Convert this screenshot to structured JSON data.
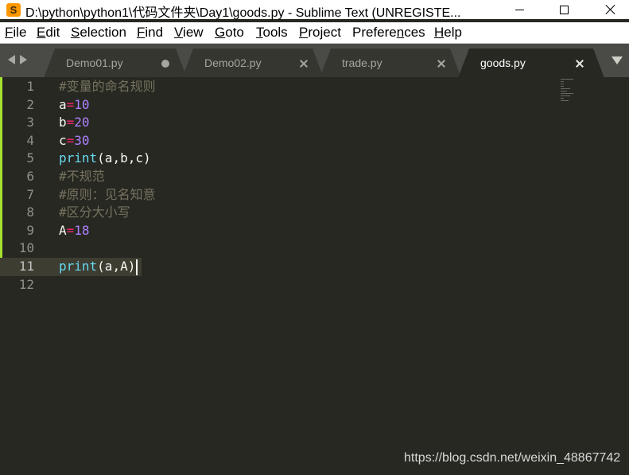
{
  "window": {
    "title": "D:\\python\\python1\\代码文件夹\\Day1\\goods.py - Sublime Text (UNREGISTE...",
    "app_icon_letter": "S"
  },
  "menu": [
    {
      "label": "File",
      "key": "F",
      "rest": "ile"
    },
    {
      "label": "Edit",
      "key": "E",
      "rest": "dit"
    },
    {
      "label": "Selection",
      "key": "S",
      "rest": "election"
    },
    {
      "label": "Find",
      "key": "F",
      "rest": "ind",
      "prefix": ""
    },
    {
      "label": "View",
      "key": "V",
      "rest": "iew"
    },
    {
      "label": "Goto",
      "key": "G",
      "rest": "oto"
    },
    {
      "label": "Tools",
      "key": "T",
      "rest": "ools"
    },
    {
      "label": "Project",
      "key": "P",
      "rest": "roject"
    },
    {
      "label": "Preferences",
      "key": "n",
      "prefix": "Prefere",
      "rest": "ces"
    },
    {
      "label": "Help",
      "key": "H",
      "rest": "elp"
    }
  ],
  "tabs": [
    {
      "label": "Demo01.py",
      "state": "modified",
      "active": false
    },
    {
      "label": "Demo02.py",
      "state": "close",
      "active": false
    },
    {
      "label": "trade.py",
      "state": "close",
      "active": false
    },
    {
      "label": "goods.py",
      "state": "close",
      "active": true
    }
  ],
  "editor": {
    "current_line": 11,
    "lines": [
      {
        "num": "1",
        "tokens": [
          {
            "t": "#变量的命名规则",
            "c": "comment"
          }
        ]
      },
      {
        "num": "2",
        "tokens": [
          {
            "t": "a",
            "c": "plain"
          },
          {
            "t": "=",
            "c": "op"
          },
          {
            "t": "10",
            "c": "num"
          }
        ]
      },
      {
        "num": "3",
        "tokens": [
          {
            "t": "b",
            "c": "plain"
          },
          {
            "t": "=",
            "c": "op"
          },
          {
            "t": "20",
            "c": "num"
          }
        ]
      },
      {
        "num": "4",
        "tokens": [
          {
            "t": "c",
            "c": "plain"
          },
          {
            "t": "=",
            "c": "op"
          },
          {
            "t": "30",
            "c": "num"
          }
        ]
      },
      {
        "num": "5",
        "tokens": [
          {
            "t": "print",
            "c": "fn"
          },
          {
            "t": "(a,b,c)",
            "c": "plain"
          }
        ]
      },
      {
        "num": "6",
        "tokens": [
          {
            "t": "#不规范",
            "c": "comment"
          }
        ]
      },
      {
        "num": "7",
        "tokens": [
          {
            "t": "#原则：见名知意",
            "c": "comment"
          }
        ]
      },
      {
        "num": "8",
        "tokens": [
          {
            "t": "#区分大小写",
            "c": "comment"
          }
        ]
      },
      {
        "num": "9",
        "tokens": [
          {
            "t": "A",
            "c": "plain"
          },
          {
            "t": "=",
            "c": "op"
          },
          {
            "t": "18",
            "c": "num"
          }
        ]
      },
      {
        "num": "10",
        "tokens": []
      },
      {
        "num": "11",
        "tokens": [
          {
            "t": "print",
            "c": "fn"
          },
          {
            "t": "(a,A)",
            "c": "plain"
          }
        ]
      },
      {
        "num": "12",
        "tokens": []
      }
    ]
  },
  "watermark": "https://blog.csdn.net/weixin_48867742",
  "colors": {
    "background": "#272822",
    "comment": "#75715e",
    "operator": "#f92672",
    "number": "#ae81ff",
    "function": "#66d9ef",
    "text": "#f8f8f2",
    "modified_bar": "#a6e22e"
  }
}
